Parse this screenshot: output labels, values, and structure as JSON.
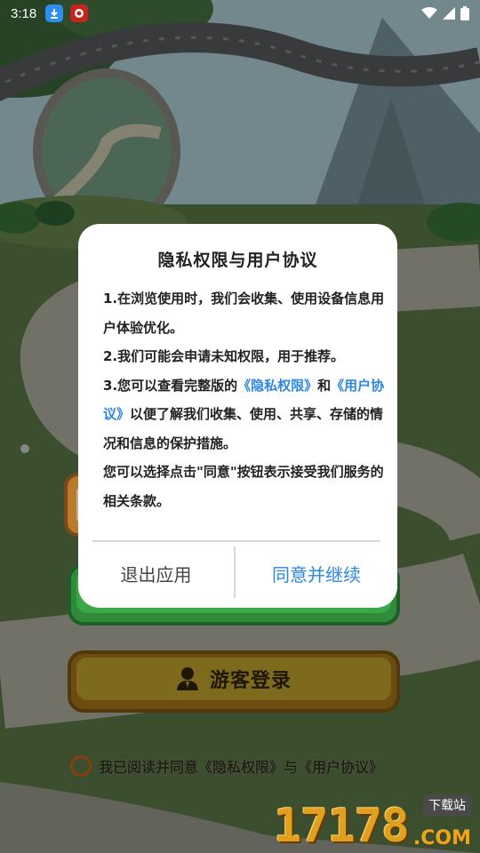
{
  "status_bar": {
    "time": "3:18"
  },
  "background": {
    "guest_button_label": "游客登录",
    "agreement_text": "我已阅读并同意《隐私权限》与《用户协议》"
  },
  "dialog": {
    "title": "隐私权限与用户协议",
    "line1": "1.在浏览使用时，我们会收集、使用设备信息用户体验优化。",
    "line2": "2.我们可能会申请未知权限，用于推荐。",
    "line3_prefix": "3.您可以查看完整版的",
    "privacy_link": "《隐私权限》",
    "line3_and": "和",
    "user_link": "《用户协议》",
    "line3_suffix": "以便了解我们收集、使用、共享、存储的情况和信息的保护措施。",
    "line4": "您可以选择点击\"同意\"按钮表示接受我们服务的相关条款。",
    "exit_button": "退出应用",
    "agree_button": "同意并继续"
  },
  "watermark": {
    "number": "17178",
    "domain": ".COM",
    "site_label": "下载站"
  },
  "colors": {
    "link_blue": "#2b87e6",
    "dialog_bg": "#ffffff",
    "grass_green": "#5f7f4a"
  }
}
